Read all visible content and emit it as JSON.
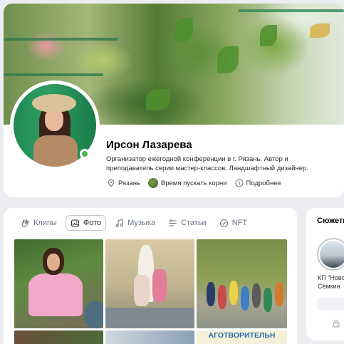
{
  "profile": {
    "name": "Ирсон Лазарева",
    "bio_line1": "Организатор ежегодной конференции в г. Рязань. Автор и",
    "bio_line2": "преподаватель серии мастер-классов. Ландшафтный дизайнер.",
    "city": "Рязань",
    "group": "Время пускать корни",
    "more": "Подробнее",
    "online": true
  },
  "media": {
    "tabs": [
      {
        "label": "Клипы",
        "icon": "clips-icon"
      },
      {
        "label": "Фото",
        "icon": "photo-icon",
        "active": true
      },
      {
        "label": "Музыка",
        "icon": "music-icon"
      },
      {
        "label": "Статьи",
        "icon": "articles-icon"
      },
      {
        "label": "NFT",
        "icon": "nft-icon"
      }
    ],
    "photo_banner_text": "АГОТВОРИТЕЛЬН"
  },
  "stories": {
    "title": "Сюжеты",
    "item_label_line1": "КП \"Ново",
    "item_label_line2": "Сёмкин"
  },
  "colors": {
    "page_bg": "#ebedf0",
    "card_bg": "#ffffff",
    "online": "#4bb34b",
    "muted_text": "#6d7885"
  }
}
